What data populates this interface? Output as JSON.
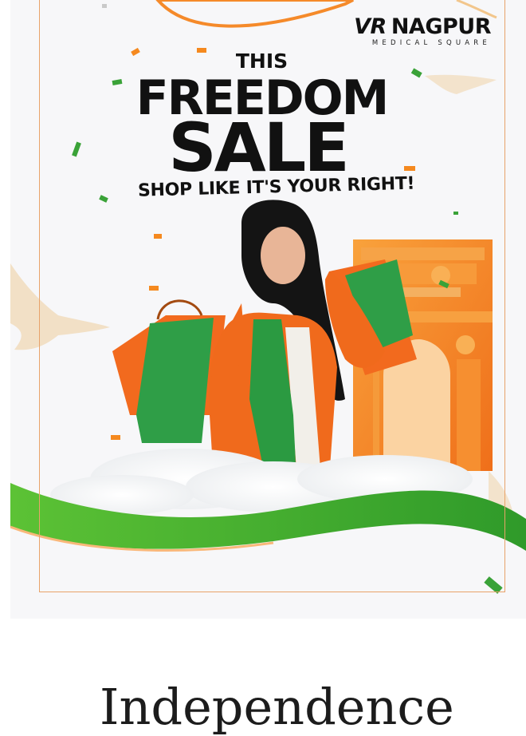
{
  "banner": {
    "logo_vr": "VR",
    "logo_name": "NAGPUR",
    "logo_subtitle": "MEDICAL SQUARE",
    "headline_line1": "THIS",
    "headline_line2": "FREEDOM",
    "headline_line3": "SALE",
    "tagline": "SHOP LIKE IT'S YOUR RIGHT!",
    "image_alt": "Woman in saffron, white and green outfit holding shopping bags in front of India Gate",
    "colors": {
      "saffron": "#f47a1f",
      "green": "#43a832",
      "frame": "#e8a36a",
      "text": "#111111"
    }
  },
  "page": {
    "heading": "Independence"
  }
}
